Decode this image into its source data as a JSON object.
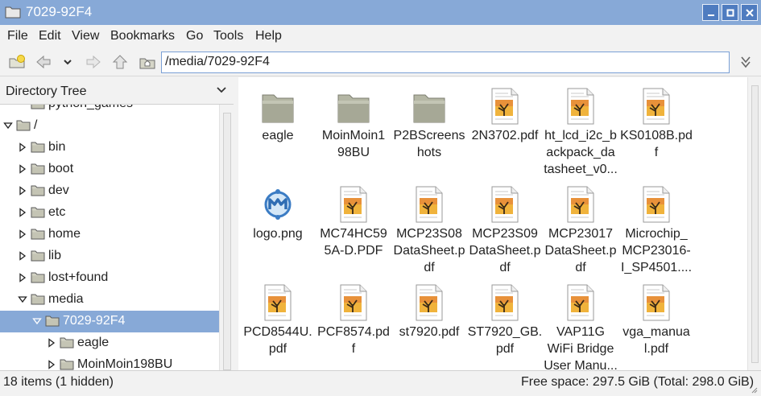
{
  "window": {
    "title": "7029-92F4",
    "controls": [
      "minimize",
      "maximize",
      "close"
    ]
  },
  "menubar": {
    "items": [
      "File",
      "Edit",
      "View",
      "Bookmarks",
      "Go",
      "Tools",
      "Help"
    ]
  },
  "toolbar": {
    "buttons": [
      "new-folder-icon",
      "back-icon",
      "history-dropdown-icon",
      "forward-icon",
      "up-icon",
      "home-icon"
    ],
    "path": "/media/7029-92F4"
  },
  "sidebar": {
    "header": "Directory Tree",
    "rows": [
      {
        "label": "python_games",
        "depth": 1,
        "expander": "none",
        "partial": true
      },
      {
        "label": "/",
        "depth": 0,
        "expander": "expanded"
      },
      {
        "label": "bin",
        "depth": 1,
        "expander": "collapsed"
      },
      {
        "label": "boot",
        "depth": 1,
        "expander": "collapsed"
      },
      {
        "label": "dev",
        "depth": 1,
        "expander": "collapsed"
      },
      {
        "label": "etc",
        "depth": 1,
        "expander": "collapsed"
      },
      {
        "label": "home",
        "depth": 1,
        "expander": "collapsed"
      },
      {
        "label": "lib",
        "depth": 1,
        "expander": "collapsed"
      },
      {
        "label": "lost+found",
        "depth": 1,
        "expander": "collapsed"
      },
      {
        "label": "media",
        "depth": 1,
        "expander": "expanded"
      },
      {
        "label": "7029-92F4",
        "depth": 2,
        "expander": "expanded",
        "selected": true
      },
      {
        "label": "eagle",
        "depth": 3,
        "expander": "collapsed"
      },
      {
        "label": "MoinMoin198BU",
        "depth": 3,
        "expander": "collapsed"
      }
    ]
  },
  "files": [
    {
      "lines": [
        "eagle"
      ],
      "icon": "folder"
    },
    {
      "lines": [
        "MoinMoin1",
        "98BU"
      ],
      "icon": "folder"
    },
    {
      "lines": [
        "P2BScreens",
        "hots"
      ],
      "icon": "folder"
    },
    {
      "lines": [
        "2N3702.pdf"
      ],
      "icon": "pdf"
    },
    {
      "lines": [
        "ht_lcd_i2c_b",
        "ackpack_da",
        "tasheet_v0..."
      ],
      "icon": "pdf"
    },
    {
      "lines": [
        "KS0108B.pd",
        "f"
      ],
      "icon": "pdf"
    },
    {
      "lines": [
        "logo.png"
      ],
      "icon": "image"
    },
    {
      "lines": [
        "MC74HC59",
        "5A-D.PDF"
      ],
      "icon": "pdf"
    },
    {
      "lines": [
        "MCP23S08",
        "DataSheet.p",
        "df"
      ],
      "icon": "pdf"
    },
    {
      "lines": [
        "MCP23S09",
        "DataSheet.p",
        "df"
      ],
      "icon": "pdf"
    },
    {
      "lines": [
        "MCP23017",
        "DataSheet.p",
        "df"
      ],
      "icon": "pdf"
    },
    {
      "lines": [
        "Microchip_",
        "MCP23016-",
        "I_SP4501...."
      ],
      "icon": "pdf"
    },
    {
      "lines": [
        "PCD8544U.",
        "pdf"
      ],
      "icon": "pdf"
    },
    {
      "lines": [
        "PCF8574.pd",
        "f"
      ],
      "icon": "pdf"
    },
    {
      "lines": [
        "st7920.pdf"
      ],
      "icon": "pdf"
    },
    {
      "lines": [
        "ST7920_GB.",
        "pdf"
      ],
      "icon": "pdf"
    },
    {
      "lines": [
        "VAP11G",
        "WiFi Bridge",
        "User Manu..."
      ],
      "icon": "pdf"
    },
    {
      "lines": [
        "vga_manua",
        "l.pdf"
      ],
      "icon": "pdf"
    }
  ],
  "status": {
    "items": "18 items (1 hidden)",
    "free": "Free space: 297.5 GiB (Total: 298.0 GiB)"
  },
  "colors": {
    "accent": "#87a9d7",
    "selection": "#87a9d7",
    "window_button": "#4f7cc0"
  }
}
